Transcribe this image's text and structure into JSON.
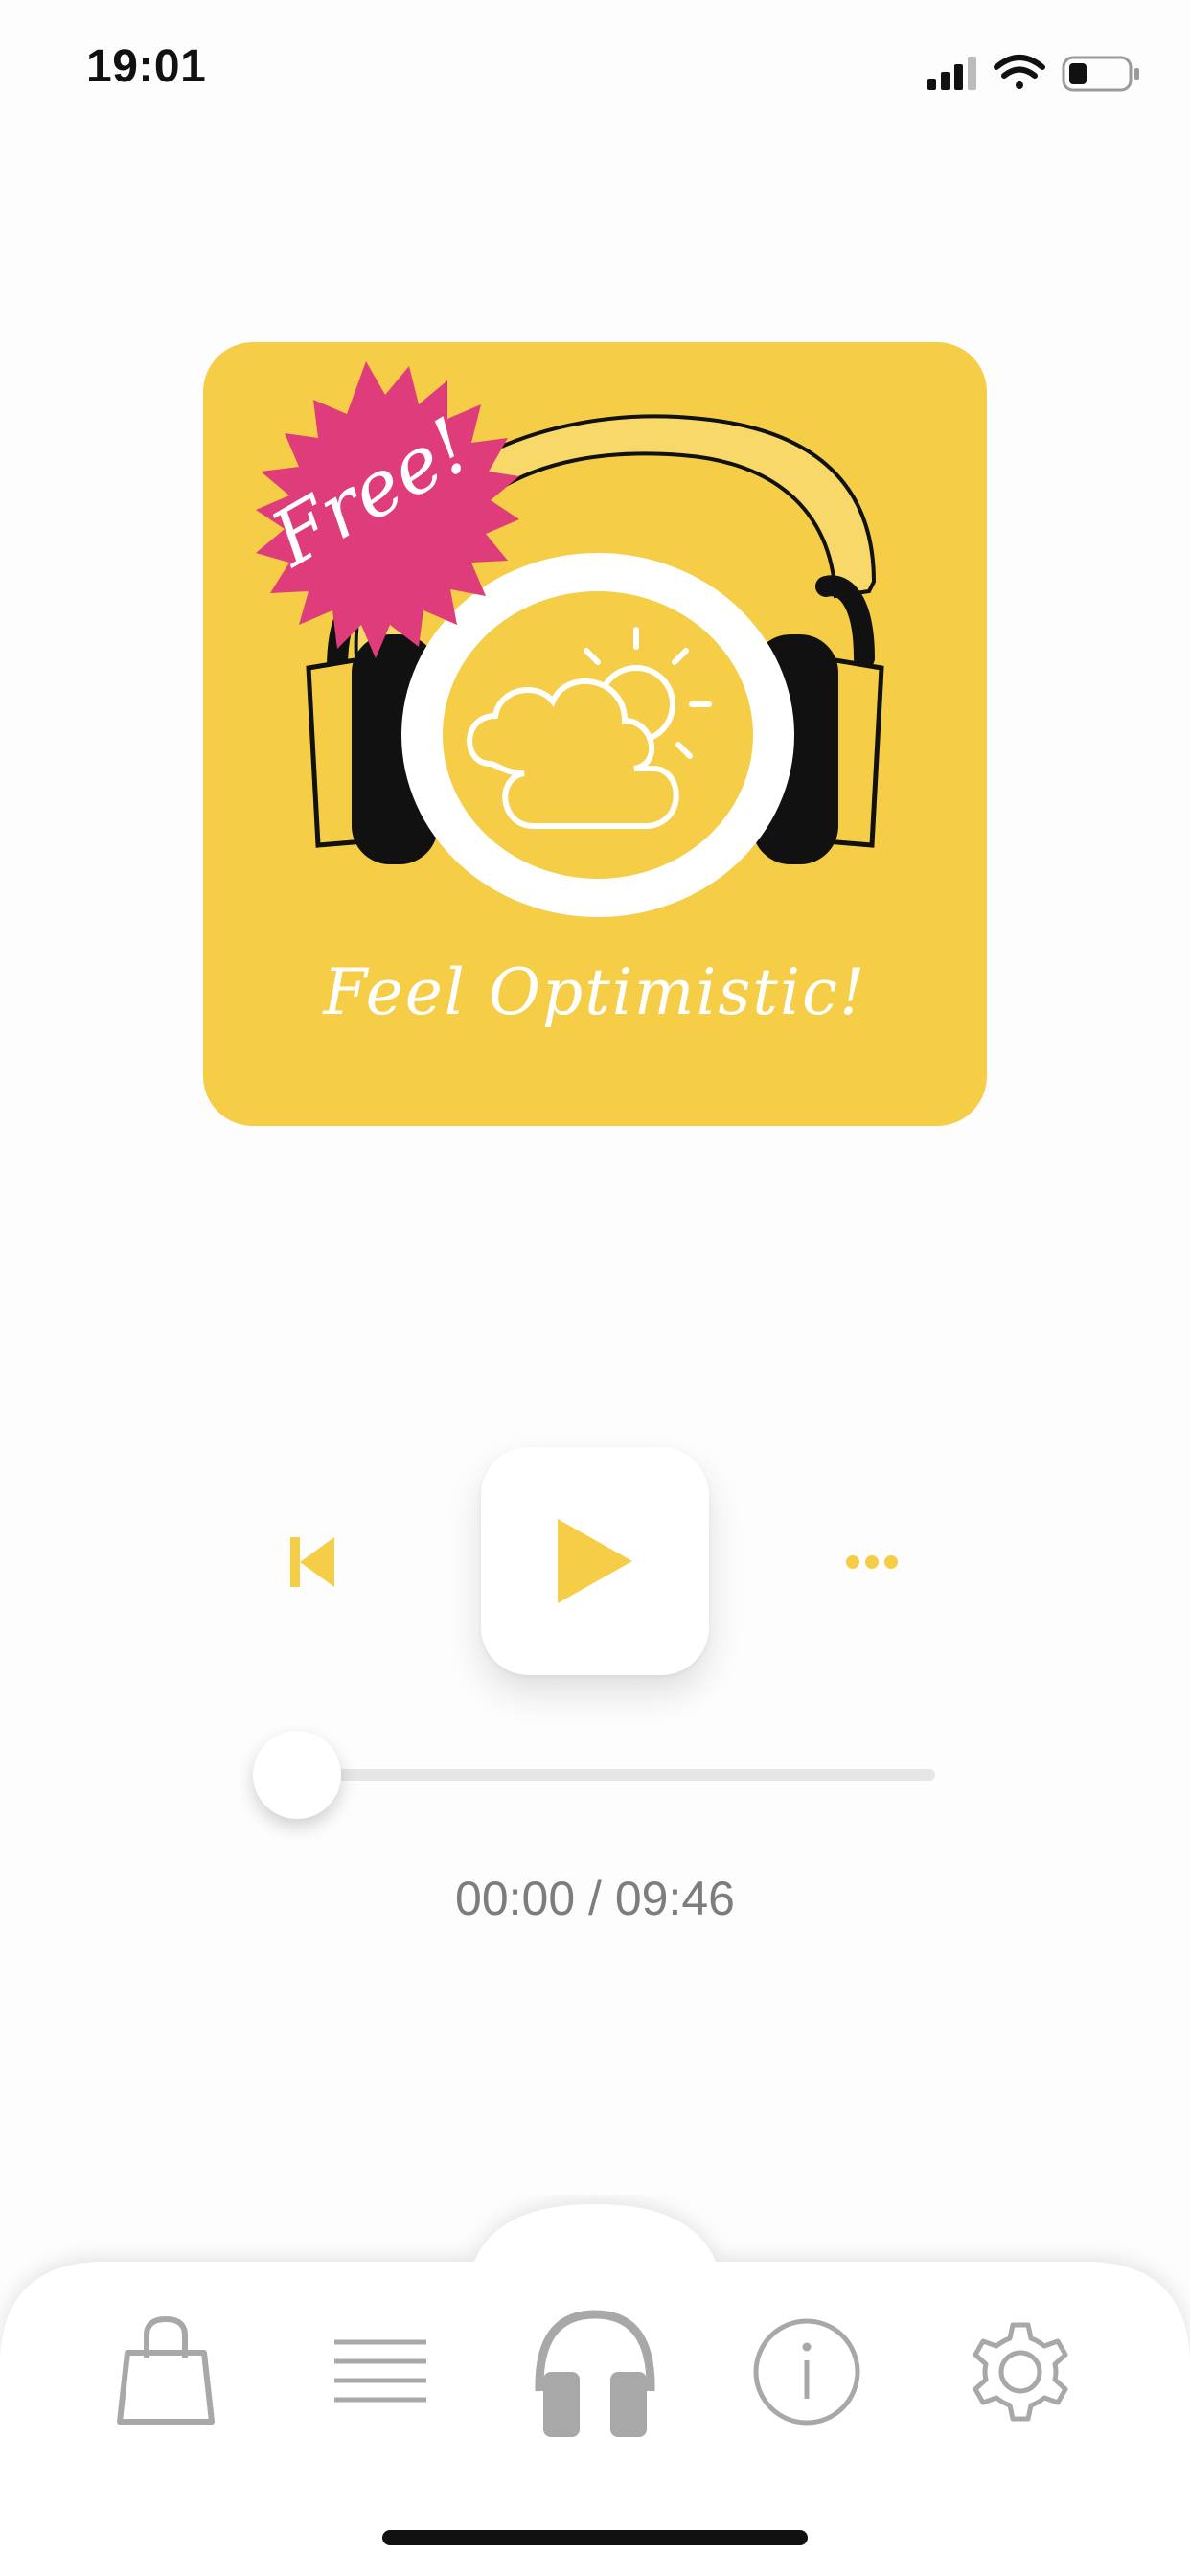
{
  "status_bar": {
    "time": "19:01",
    "icons": [
      "cellular-signal-icon",
      "wifi-icon",
      "battery-icon"
    ]
  },
  "artwork": {
    "badge_text": "Free!",
    "title": "Feel Optimistic!",
    "illustration": [
      "headphones-icon",
      "partly-cloudy-icon"
    ],
    "colors": {
      "background": "#f5cd47",
      "badge": "#de3c7a"
    }
  },
  "player": {
    "controls": [
      "previous-icon",
      "play-icon",
      "more-icon"
    ],
    "progress_fraction": 0,
    "elapsed": "00:00",
    "duration": "09:46",
    "time_readout": "00:00 / 09:46",
    "accent_color": "#f5cd47"
  },
  "tab_bar": {
    "tabs": [
      {
        "icon": "shopping-bag-icon",
        "active": false
      },
      {
        "icon": "list-icon",
        "active": false
      },
      {
        "icon": "headphones-icon",
        "active": true
      },
      {
        "icon": "info-icon",
        "active": false
      },
      {
        "icon": "gear-icon",
        "active": false
      }
    ]
  }
}
